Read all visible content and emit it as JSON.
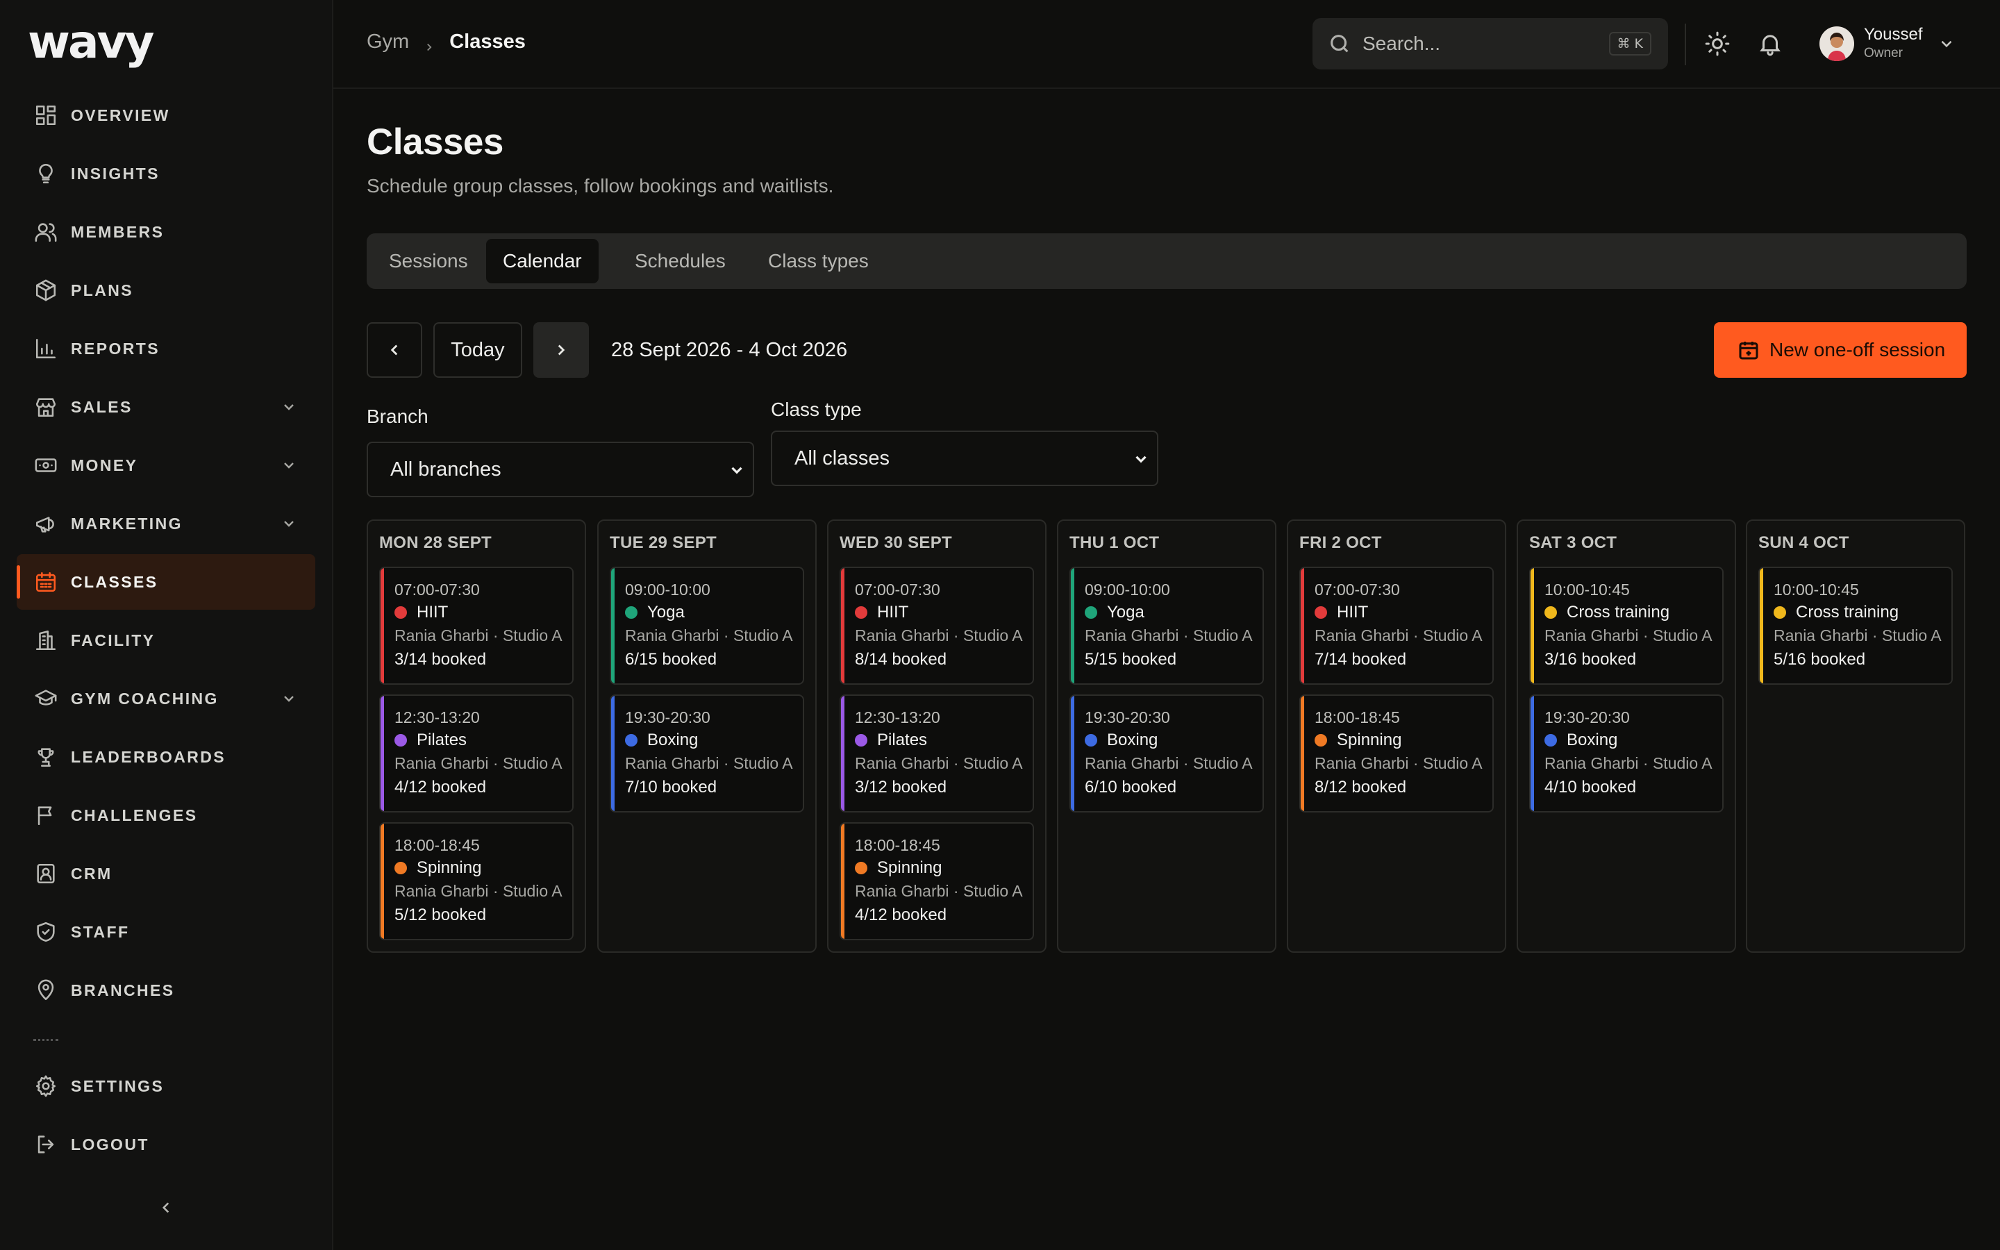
{
  "brand": {
    "logo": "wavy",
    "accent": "#ff5a1f"
  },
  "sidebar": {
    "items": [
      {
        "label": "OVERVIEW",
        "icon": "grid-icon"
      },
      {
        "label": "INSIGHTS",
        "icon": "lightbulb-icon"
      },
      {
        "label": "MEMBERS",
        "icon": "users-icon"
      },
      {
        "label": "PLANS",
        "icon": "package-icon"
      },
      {
        "label": "REPORTS",
        "icon": "bar-chart-icon"
      },
      {
        "label": "SALES",
        "icon": "store-icon",
        "expandable": true
      },
      {
        "label": "MONEY",
        "icon": "banknote-icon",
        "expandable": true
      },
      {
        "label": "MARKETING",
        "icon": "megaphone-icon",
        "expandable": true
      },
      {
        "label": "CLASSES",
        "icon": "calendar-icon",
        "active": true
      },
      {
        "label": "FACILITY",
        "icon": "building-icon"
      },
      {
        "label": "GYM COACHING",
        "icon": "graduation-cap-icon",
        "expandable": true
      },
      {
        "label": "LEADERBOARDS",
        "icon": "trophy-icon"
      },
      {
        "label": "CHALLENGES",
        "icon": "flag-icon"
      },
      {
        "label": "CRM",
        "icon": "contact-icon"
      },
      {
        "label": "STAFF",
        "icon": "shield-icon"
      },
      {
        "label": "BRANCHES",
        "icon": "map-pin-icon"
      }
    ],
    "bottom": [
      {
        "label": "SETTINGS",
        "icon": "gear-icon"
      },
      {
        "label": "LOGOUT",
        "icon": "logout-icon"
      }
    ]
  },
  "header": {
    "breadcrumb": [
      "Gym",
      "Classes"
    ],
    "search": {
      "placeholder": "Search...",
      "shortcut": "⌘ K"
    },
    "user": {
      "name": "Youssef",
      "role": "Owner"
    }
  },
  "page": {
    "title": "Classes",
    "subtitle": "Schedule group classes, follow bookings and waitlists.",
    "tabs": [
      "Sessions",
      "Calendar",
      "Schedules",
      "Class types"
    ],
    "active_tab": "Calendar"
  },
  "toolbar": {
    "today_label": "Today",
    "date_range": "28 Sept 2026 - 4 Oct 2026",
    "new_session_label": "New one-off session"
  },
  "filters": {
    "branch": {
      "label": "Branch",
      "value": "All branches"
    },
    "class_type": {
      "label": "Class type",
      "value": "All classes"
    }
  },
  "class_colors": {
    "HIIT": "#e23b3b",
    "Pilates": "#9b59e6",
    "Spinning": "#f07a24",
    "Yoga": "#1fa57a",
    "Boxing": "#3d6be3",
    "Cross training": "#f0b81c"
  },
  "calendar": {
    "days": [
      {
        "label": "MON 28 SEPT",
        "events": [
          {
            "time": "07:00-07:30",
            "name": "HIIT",
            "coach": "Rania Gharbi · Studio A",
            "booked": "3/14 booked"
          },
          {
            "time": "12:30-13:20",
            "name": "Pilates",
            "coach": "Rania Gharbi · Studio A",
            "booked": "4/12 booked"
          },
          {
            "time": "18:00-18:45",
            "name": "Spinning",
            "coach": "Rania Gharbi · Studio A",
            "booked": "5/12 booked"
          }
        ]
      },
      {
        "label": "TUE 29 SEPT",
        "events": [
          {
            "time": "09:00-10:00",
            "name": "Yoga",
            "coach": "Rania Gharbi · Studio A",
            "booked": "6/15 booked"
          },
          {
            "time": "19:30-20:30",
            "name": "Boxing",
            "coach": "Rania Gharbi · Studio A",
            "booked": "7/10 booked"
          }
        ]
      },
      {
        "label": "WED 30 SEPT",
        "events": [
          {
            "time": "07:00-07:30",
            "name": "HIIT",
            "coach": "Rania Gharbi · Studio A",
            "booked": "8/14 booked"
          },
          {
            "time": "12:30-13:20",
            "name": "Pilates",
            "coach": "Rania Gharbi · Studio A",
            "booked": "3/12 booked"
          },
          {
            "time": "18:00-18:45",
            "name": "Spinning",
            "coach": "Rania Gharbi · Studio A",
            "booked": "4/12 booked"
          }
        ]
      },
      {
        "label": "THU 1 OCT",
        "events": [
          {
            "time": "09:00-10:00",
            "name": "Yoga",
            "coach": "Rania Gharbi · Studio A",
            "booked": "5/15 booked"
          },
          {
            "time": "19:30-20:30",
            "name": "Boxing",
            "coach": "Rania Gharbi · Studio A",
            "booked": "6/10 booked"
          }
        ]
      },
      {
        "label": "FRI 2 OCT",
        "events": [
          {
            "time": "07:00-07:30",
            "name": "HIIT",
            "coach": "Rania Gharbi · Studio A",
            "booked": "7/14 booked"
          },
          {
            "time": "18:00-18:45",
            "name": "Spinning",
            "coach": "Rania Gharbi · Studio A",
            "booked": "8/12 booked"
          }
        ]
      },
      {
        "label": "SAT 3 OCT",
        "events": [
          {
            "time": "10:00-10:45",
            "name": "Cross training",
            "coach": "Rania Gharbi · Studio A",
            "booked": "3/16 booked"
          },
          {
            "time": "19:30-20:30",
            "name": "Boxing",
            "coach": "Rania Gharbi · Studio A",
            "booked": "4/10 booked"
          }
        ]
      },
      {
        "label": "SUN 4 OCT",
        "events": [
          {
            "time": "10:00-10:45",
            "name": "Cross training",
            "coach": "Rania Gharbi · Studio A",
            "booked": "5/16 booked"
          }
        ]
      }
    ]
  }
}
